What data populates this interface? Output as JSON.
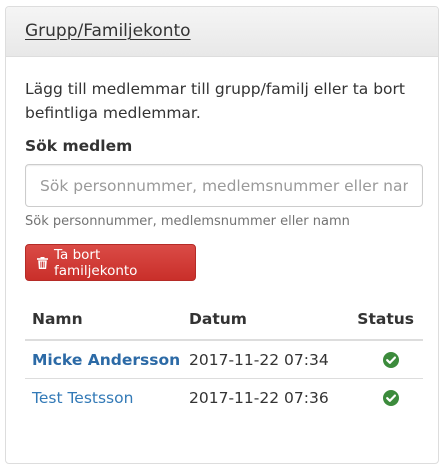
{
  "panel": {
    "title": "Grupp/Familjekonto"
  },
  "intro": "Lägg till medlemmar till grupp/familj eller ta bort befintliga medlemmar.",
  "search": {
    "label": "Sök medlem",
    "placeholder": "Sök personnummer, medlemsnummer eller namn",
    "value": "",
    "help": "Sök personnummer, medlemsnummer eller namn"
  },
  "delete_button": {
    "label": "Ta bort familjekonto",
    "icon": "trash-icon",
    "color": "#d9534f"
  },
  "table": {
    "headers": [
      "Namn",
      "Datum",
      "Status"
    ],
    "rows": [
      {
        "name": "Micke Andersson",
        "date": "2017-11-22 07:34",
        "status_icon": "check-circle-icon",
        "bold": true
      },
      {
        "name": "Test Testsson",
        "date": "2017-11-22 07:36",
        "status_icon": "check-circle-icon",
        "bold": false
      }
    ]
  },
  "colors": {
    "link": "#337ab7",
    "success": "#3c8b3c",
    "danger": "#d9534f"
  }
}
